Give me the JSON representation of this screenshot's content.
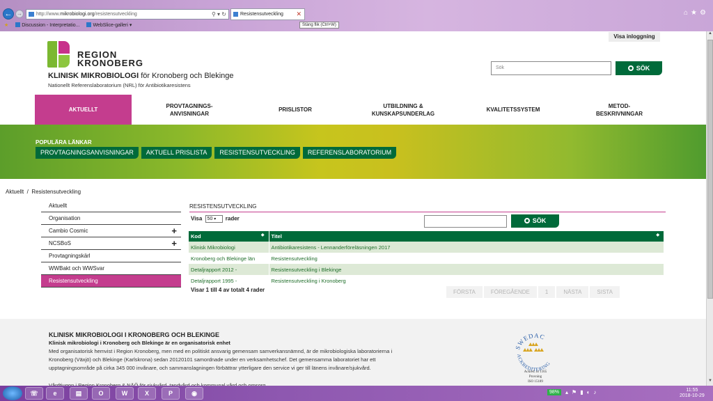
{
  "browser": {
    "url_prefix": "http://www.",
    "url_domain": "mikrobiologi.org",
    "url_path": "/resistensutveckling",
    "tab_title": "Resistensutveckling",
    "tooltip": "Stäng flik (Ctrl+W)",
    "favorites": [
      "Discussion - Interpretatio...",
      "WebSlice-galleri ▾"
    ]
  },
  "header": {
    "login": "Visa inloggning",
    "logo_line1": "REGION",
    "logo_line2": "KRONOBERG",
    "title_bold": "KLINISK MIKROBIOLOGI",
    "title_rest": " för Kronoberg och Blekinge",
    "subtitle": "Nationellt Referenslaboratorium (NRL) för Antibiotikaresistens",
    "search_placeholder": "Sök",
    "search_button": "SÖK"
  },
  "nav": [
    {
      "label": "AKTUELLT"
    },
    {
      "label": "PROVTAGNINGS-\nANVISNINGAR"
    },
    {
      "label": "PRISLISTOR"
    },
    {
      "label": "UTBILDNING &\nKUNSKAPSUNDERLAG"
    },
    {
      "label": "KVALITETSSYSTEM"
    },
    {
      "label": "METOD-\nBESKRIVNINGAR"
    }
  ],
  "popular": {
    "title": "POPULÄRA LÄNKAR",
    "links": [
      "PROVTAGNINGSANVISNINGAR",
      "AKTUELL PRISLISTA",
      "RESISTENSUTVECKLING",
      "REFERENSLABORATORIUM"
    ]
  },
  "breadcrumb": "Aktuellt  /  Resistensutveckling",
  "sidebar": [
    {
      "label": "Aktuellt",
      "expand": ""
    },
    {
      "label": "Organisation",
      "expand": ""
    },
    {
      "label": "Cambio Cosmic",
      "expand": "+"
    },
    {
      "label": "NCSBoS",
      "expand": "+"
    },
    {
      "label": "Provtagningskärl",
      "expand": ""
    },
    {
      "label": "WWBakt och WWSvar",
      "expand": ""
    },
    {
      "label": "Resistensutveckling",
      "expand": ""
    }
  ],
  "content": {
    "title": "RESISTENSUTVECKLING",
    "show_label": "Visa",
    "show_value": "50",
    "rows_label": "rader",
    "search_button": "SÖK",
    "columns": [
      "Kod",
      "Titel"
    ],
    "rows": [
      [
        "Klinisk Mikrobiologi",
        "Antibiotikaresistens - Lennanderföreläsningen 2017"
      ],
      [
        "Kronoberg och Blekinge län",
        "Resistensutveckling"
      ],
      [
        "Detaljrapport 2012 -",
        "Resistensutveckling i Blekinge"
      ],
      [
        "Detaljrapport 1995 -",
        "Resistensutveckling i Kronoberg"
      ]
    ],
    "info": "Visar 1 till 4 av totalt 4 rader",
    "pager": [
      "FÖRSTA",
      "FÖREGÅENDE",
      "1",
      "NÄSTA",
      "SISTA"
    ]
  },
  "footer": {
    "title": "KLINISK MIKROBIOLOGI I KRONOBERG OCH BLEKINGE",
    "subtitle": "Klinisk mikrobiologi i Kronoberg och Blekinge är en organisatorisk enhet",
    "body": "Med organisatorisk hemvist i Region Kronoberg, men med en politiskt ansvarig gemensam samverkansnämnd, är de mikrobiologiska laboratorierna i Kronoberg (Växjö) och Blekinge (Karlskrona) sedan 20120101 samordnade under en verksamhetschef. Det gemensamma laboratoriet har ett upptagningsområde på cirka 345 000 invånare, och sammanslagningen förbättrar ytterligare den service vi ger till länens invånare/sjukvård.",
    "cut_line": "Vårdtjugon i Region Kronoberg & NÄÖ för sjukvård, tandvård och kommunal vård och omsorg",
    "swedac_top": "SWEDAC",
    "swedac_bottom": "ACKREDITERING",
    "swedac_line1": "Ackred. nr 1165",
    "swedac_line2": "Provning",
    "swedac_line3": "ISO 15189"
  },
  "taskbar": {
    "battery": "98%",
    "time": "11:55",
    "date": "2018-10-29"
  }
}
